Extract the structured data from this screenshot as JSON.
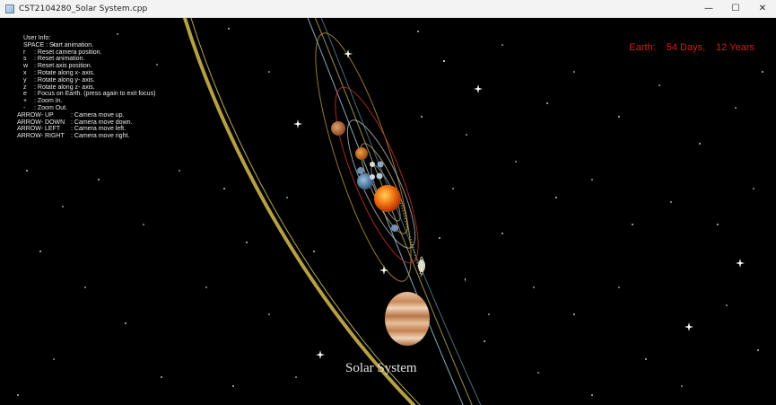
{
  "window": {
    "title": "CST2104280_Solar System.cpp",
    "controls": [
      "—",
      "☐",
      "✕"
    ]
  },
  "user_info": {
    "heading": "User Info:",
    "space": {
      "key": "SPACE",
      "text": ": Start animation."
    },
    "items": [
      {
        "key": "r",
        "text": ": Reset camera position."
      },
      {
        "key": "s",
        "text": ": Reset animation."
      },
      {
        "key": "w",
        "text": ": Reset axis position."
      },
      {
        "key": "x",
        "text": ": Rotate along x- axis."
      },
      {
        "key": "y",
        "text": ": Rotate along y- axis."
      },
      {
        "key": "z",
        "text": ": Rotate along z- axis."
      },
      {
        "key": "e",
        "text": ": Focus on Earth. (press again to exit focus)"
      },
      {
        "key": "+",
        "text": ": Zoom In."
      },
      {
        "key": "-",
        "text": ": Zoom Out."
      }
    ],
    "arrows": [
      {
        "key": "ARROW- UP",
        "text": ": Camera move up."
      },
      {
        "key": "ARROW- DOWN",
        "text": ": Camera move down."
      },
      {
        "key": "ARROW- LEFT",
        "text": ": Camera move left."
      },
      {
        "key": "ARROW- RIGHT",
        "text": ": Camera move right."
      }
    ]
  },
  "status": {
    "label": "Earth:",
    "days": "54 Days,",
    "years": "12 Years"
  },
  "caption": "Solar System",
  "colors": {
    "status_text": "#e0161b",
    "sun": "#f26a10",
    "jupiter": "#d9a07a",
    "outer_orbit": "#c9b24a",
    "background": "#000000"
  }
}
